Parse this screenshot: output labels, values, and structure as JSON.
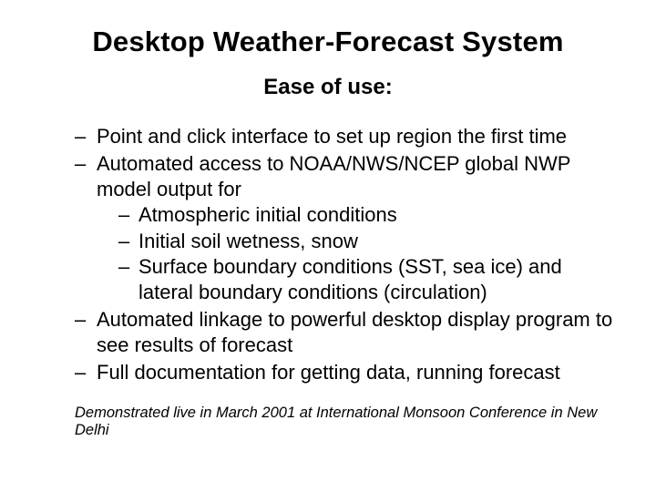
{
  "title": "Desktop Weather-Forecast System",
  "subtitle": "Ease of use:",
  "bullets": {
    "b1": "Point and click interface to set up region the first time",
    "b2": "Automated access to NOAA/NWS/NCEP global NWP model output for",
    "b2s1": "Atmospheric initial conditions",
    "b2s2": "Initial soil wetness, snow",
    "b2s3": "Surface boundary conditions (SST, sea ice) and lateral boundary conditions (circulation)",
    "b3": "Automated linkage to powerful desktop display program to see results of forecast",
    "b4": "Full documentation for getting data, running forecast"
  },
  "footnote": "Demonstrated live in March 2001 at International Monsoon Conference in New Delhi"
}
